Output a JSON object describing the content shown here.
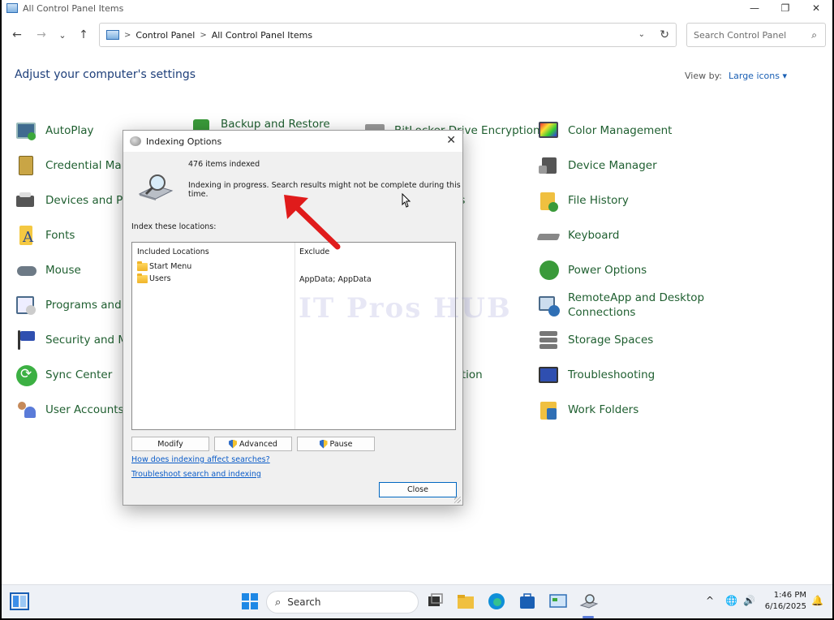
{
  "window": {
    "title": "All Control Panel Items",
    "controls": {
      "minimize": "—",
      "maximize": "❐",
      "close": "✕"
    }
  },
  "nav": {
    "back": "←",
    "forward": "→",
    "recent": "⌄",
    "up": "↑",
    "breadcrumbs": [
      "Control Panel",
      "All Control Panel Items"
    ],
    "separator": ">",
    "search_placeholder": "Search Control Panel"
  },
  "header": {
    "title": "Adjust your computer's settings",
    "view_by_label": "View by:",
    "view_by_value": "Large icons ▾"
  },
  "items": {
    "col1": [
      "AutoPlay",
      "Credential Mana",
      "Devices and Prin",
      "Fonts",
      "Mouse",
      "Programs and F",
      "Security and Ma",
      "Sync Center",
      "User Accounts"
    ],
    "col2_top": "Backup and Restore",
    "col3": [
      "BitLocker Drive Encryption",
      "ms",
      "ptions",
      "ns",
      "odem",
      "",
      "nition",
      "avigation",
      "s"
    ],
    "col4": [
      "Color Management",
      "Device Manager",
      "File History",
      "Keyboard",
      "Power Options",
      "RemoteApp and Desktop Connections",
      "Storage Spaces",
      "Troubleshooting",
      "Work Folders"
    ]
  },
  "watermark": "IT Pros HUB",
  "dialog": {
    "title": "Indexing Options",
    "close": "✕",
    "count": "476 items indexed",
    "status": "Indexing in progress. Search results might not be complete during this time.",
    "index_label": "Index these locations:",
    "col_included": "Included Locations",
    "col_exclude": "Exclude",
    "locations": [
      "Start Menu",
      "Users"
    ],
    "exclude_users": "AppData; AppData",
    "buttons": {
      "modify": "Modify",
      "advanced": "Advanced",
      "pause": "Pause",
      "close": "Close"
    },
    "links": [
      "How does indexing affect searches?",
      "Troubleshoot search and indexing"
    ]
  },
  "taskbar": {
    "search": "Search",
    "time": "1:46 PM",
    "date": "6/16/2025",
    "tray_chevron": "^"
  }
}
